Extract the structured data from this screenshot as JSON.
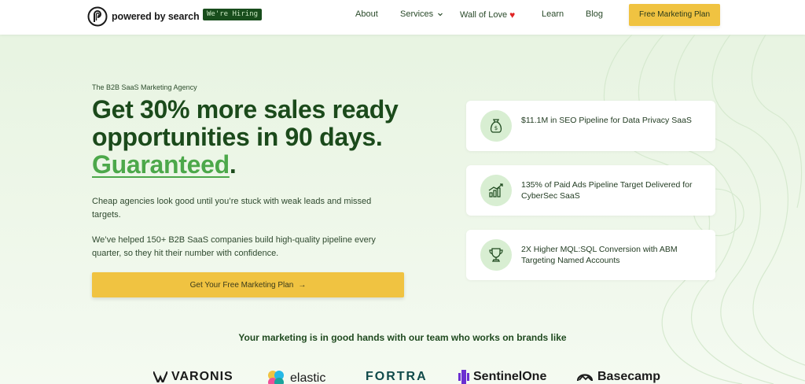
{
  "header": {
    "logo_text": "powered by search",
    "hiring_badge": "We're Hiring",
    "nav": {
      "about": "About",
      "services": "Services",
      "wall_of_love": "Wall of Love",
      "learn": "Learn",
      "blog": "Blog"
    },
    "cta": "Free Marketing Plan"
  },
  "hero": {
    "eyebrow": "The B2B SaaS Marketing Agency",
    "headline_main": "Get 30% more sales ready opportunities in 90 days.",
    "headline_highlight": "Guaranteed",
    "headline_end": ".",
    "paragraph1": "Cheap agencies look good until you’re stuck with weak leads and missed targets.",
    "paragraph2": "We’ve helped 150+ B2B SaaS companies build high-quality pipeline every quarter, so they hit their number with confidence.",
    "cta": "Get Your Free Marketing Plan",
    "cta_arrow": "→"
  },
  "stats": [
    {
      "icon": "money-bag-icon",
      "text": "$11.1M in SEO Pipeline for Data Privacy SaaS"
    },
    {
      "icon": "growth-chart-icon",
      "text": "135% of Paid Ads Pipeline Target Delivered for CyberSec SaaS"
    },
    {
      "icon": "trophy-icon",
      "text": "2X Higher MQL:SQL Conversion with ABM Targeting Named Accounts"
    }
  ],
  "trust": {
    "heading": "Your marketing is in good hands with our team who works on brands like",
    "brands": [
      "VARONIS",
      "elastic",
      "FORTRA",
      "SentinelOne",
      "Basecamp"
    ]
  },
  "colors": {
    "accent_yellow": "#f0c341",
    "brand_green": "#1b4a1b",
    "highlight_green": "#4ca84a",
    "badge_bg": "#184d1c"
  }
}
